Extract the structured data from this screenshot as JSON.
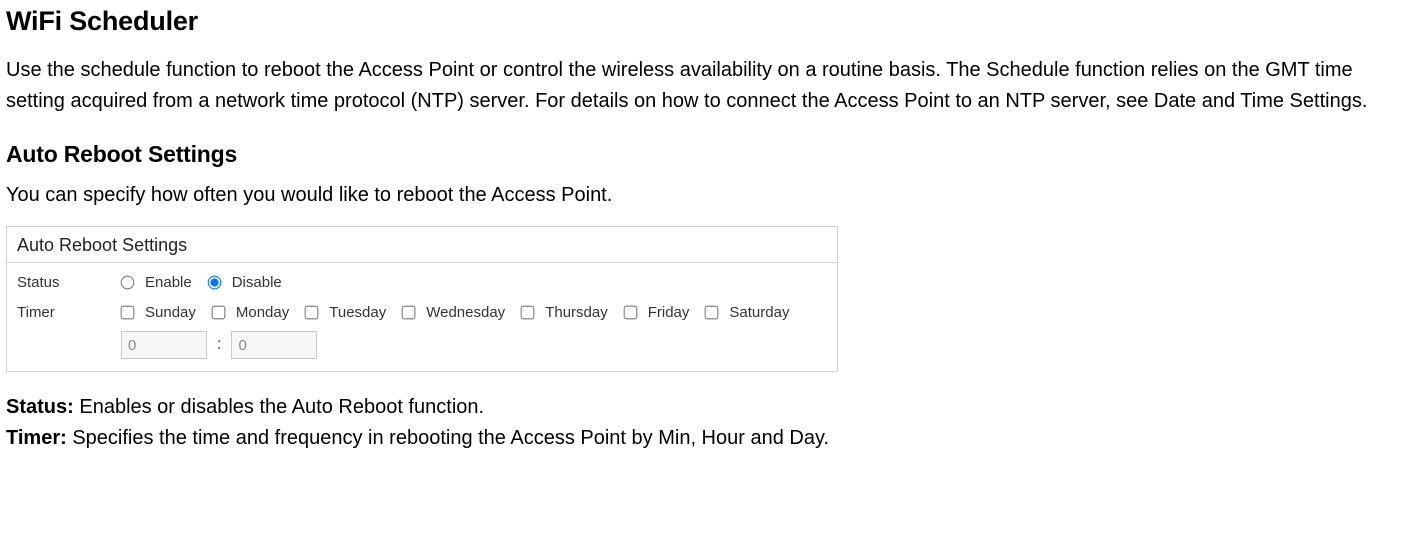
{
  "page": {
    "heading": "WiFi Scheduler",
    "intro": "Use the schedule function to reboot the Access Point or control the wireless availability on a routine basis. The Schedule function relies on the GMT time setting acquired from a network time protocol (NTP) server. For details on how to connect the Access Point to an NTP server, see Date and Time Settings."
  },
  "section": {
    "heading": "Auto Reboot Settings",
    "intro": "You can specify how often you would like to reboot the Access Point."
  },
  "panel": {
    "title": "Auto Reboot Settings",
    "status": {
      "label": "Status",
      "enable_label": "Enable",
      "disable_label": "Disable",
      "selected": "disable"
    },
    "timer": {
      "label": "Timer",
      "days": [
        "Sunday",
        "Monday",
        "Tuesday",
        "Wednesday",
        "Thursday",
        "Friday",
        "Saturday"
      ],
      "hour_value": "0",
      "minute_value": "0",
      "separator": ":"
    }
  },
  "defs": {
    "status_label": "Status:",
    "status_text": " Enables or disables the Auto Reboot function.",
    "timer_label": "Timer:",
    "timer_text": " Specifies the time and frequency in rebooting the Access Point by Min, Hour and Day."
  }
}
